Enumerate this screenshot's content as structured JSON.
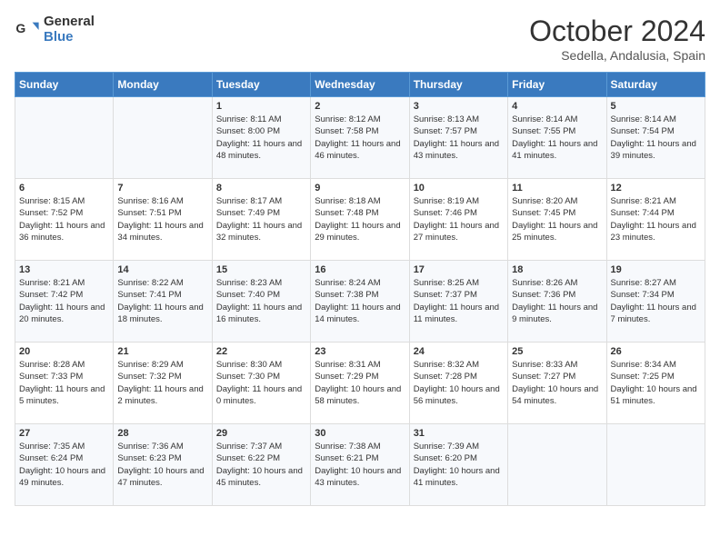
{
  "logo": {
    "text_general": "General",
    "text_blue": "Blue"
  },
  "title": "October 2024",
  "subtitle": "Sedella, Andalusia, Spain",
  "days_of_week": [
    "Sunday",
    "Monday",
    "Tuesday",
    "Wednesday",
    "Thursday",
    "Friday",
    "Saturday"
  ],
  "weeks": [
    [
      {
        "day": "",
        "sunrise": "",
        "sunset": "",
        "daylight": ""
      },
      {
        "day": "",
        "sunrise": "",
        "sunset": "",
        "daylight": ""
      },
      {
        "day": "1",
        "sunrise": "Sunrise: 8:11 AM",
        "sunset": "Sunset: 8:00 PM",
        "daylight": "Daylight: 11 hours and 48 minutes."
      },
      {
        "day": "2",
        "sunrise": "Sunrise: 8:12 AM",
        "sunset": "Sunset: 7:58 PM",
        "daylight": "Daylight: 11 hours and 46 minutes."
      },
      {
        "day": "3",
        "sunrise": "Sunrise: 8:13 AM",
        "sunset": "Sunset: 7:57 PM",
        "daylight": "Daylight: 11 hours and 43 minutes."
      },
      {
        "day": "4",
        "sunrise": "Sunrise: 8:14 AM",
        "sunset": "Sunset: 7:55 PM",
        "daylight": "Daylight: 11 hours and 41 minutes."
      },
      {
        "day": "5",
        "sunrise": "Sunrise: 8:14 AM",
        "sunset": "Sunset: 7:54 PM",
        "daylight": "Daylight: 11 hours and 39 minutes."
      }
    ],
    [
      {
        "day": "6",
        "sunrise": "Sunrise: 8:15 AM",
        "sunset": "Sunset: 7:52 PM",
        "daylight": "Daylight: 11 hours and 36 minutes."
      },
      {
        "day": "7",
        "sunrise": "Sunrise: 8:16 AM",
        "sunset": "Sunset: 7:51 PM",
        "daylight": "Daylight: 11 hours and 34 minutes."
      },
      {
        "day": "8",
        "sunrise": "Sunrise: 8:17 AM",
        "sunset": "Sunset: 7:49 PM",
        "daylight": "Daylight: 11 hours and 32 minutes."
      },
      {
        "day": "9",
        "sunrise": "Sunrise: 8:18 AM",
        "sunset": "Sunset: 7:48 PM",
        "daylight": "Daylight: 11 hours and 29 minutes."
      },
      {
        "day": "10",
        "sunrise": "Sunrise: 8:19 AM",
        "sunset": "Sunset: 7:46 PM",
        "daylight": "Daylight: 11 hours and 27 minutes."
      },
      {
        "day": "11",
        "sunrise": "Sunrise: 8:20 AM",
        "sunset": "Sunset: 7:45 PM",
        "daylight": "Daylight: 11 hours and 25 minutes."
      },
      {
        "day": "12",
        "sunrise": "Sunrise: 8:21 AM",
        "sunset": "Sunset: 7:44 PM",
        "daylight": "Daylight: 11 hours and 23 minutes."
      }
    ],
    [
      {
        "day": "13",
        "sunrise": "Sunrise: 8:21 AM",
        "sunset": "Sunset: 7:42 PM",
        "daylight": "Daylight: 11 hours and 20 minutes."
      },
      {
        "day": "14",
        "sunrise": "Sunrise: 8:22 AM",
        "sunset": "Sunset: 7:41 PM",
        "daylight": "Daylight: 11 hours and 18 minutes."
      },
      {
        "day": "15",
        "sunrise": "Sunrise: 8:23 AM",
        "sunset": "Sunset: 7:40 PM",
        "daylight": "Daylight: 11 hours and 16 minutes."
      },
      {
        "day": "16",
        "sunrise": "Sunrise: 8:24 AM",
        "sunset": "Sunset: 7:38 PM",
        "daylight": "Daylight: 11 hours and 14 minutes."
      },
      {
        "day": "17",
        "sunrise": "Sunrise: 8:25 AM",
        "sunset": "Sunset: 7:37 PM",
        "daylight": "Daylight: 11 hours and 11 minutes."
      },
      {
        "day": "18",
        "sunrise": "Sunrise: 8:26 AM",
        "sunset": "Sunset: 7:36 PM",
        "daylight": "Daylight: 11 hours and 9 minutes."
      },
      {
        "day": "19",
        "sunrise": "Sunrise: 8:27 AM",
        "sunset": "Sunset: 7:34 PM",
        "daylight": "Daylight: 11 hours and 7 minutes."
      }
    ],
    [
      {
        "day": "20",
        "sunrise": "Sunrise: 8:28 AM",
        "sunset": "Sunset: 7:33 PM",
        "daylight": "Daylight: 11 hours and 5 minutes."
      },
      {
        "day": "21",
        "sunrise": "Sunrise: 8:29 AM",
        "sunset": "Sunset: 7:32 PM",
        "daylight": "Daylight: 11 hours and 2 minutes."
      },
      {
        "day": "22",
        "sunrise": "Sunrise: 8:30 AM",
        "sunset": "Sunset: 7:30 PM",
        "daylight": "Daylight: 11 hours and 0 minutes."
      },
      {
        "day": "23",
        "sunrise": "Sunrise: 8:31 AM",
        "sunset": "Sunset: 7:29 PM",
        "daylight": "Daylight: 10 hours and 58 minutes."
      },
      {
        "day": "24",
        "sunrise": "Sunrise: 8:32 AM",
        "sunset": "Sunset: 7:28 PM",
        "daylight": "Daylight: 10 hours and 56 minutes."
      },
      {
        "day": "25",
        "sunrise": "Sunrise: 8:33 AM",
        "sunset": "Sunset: 7:27 PM",
        "daylight": "Daylight: 10 hours and 54 minutes."
      },
      {
        "day": "26",
        "sunrise": "Sunrise: 8:34 AM",
        "sunset": "Sunset: 7:25 PM",
        "daylight": "Daylight: 10 hours and 51 minutes."
      }
    ],
    [
      {
        "day": "27",
        "sunrise": "Sunrise: 7:35 AM",
        "sunset": "Sunset: 6:24 PM",
        "daylight": "Daylight: 10 hours and 49 minutes."
      },
      {
        "day": "28",
        "sunrise": "Sunrise: 7:36 AM",
        "sunset": "Sunset: 6:23 PM",
        "daylight": "Daylight: 10 hours and 47 minutes."
      },
      {
        "day": "29",
        "sunrise": "Sunrise: 7:37 AM",
        "sunset": "Sunset: 6:22 PM",
        "daylight": "Daylight: 10 hours and 45 minutes."
      },
      {
        "day": "30",
        "sunrise": "Sunrise: 7:38 AM",
        "sunset": "Sunset: 6:21 PM",
        "daylight": "Daylight: 10 hours and 43 minutes."
      },
      {
        "day": "31",
        "sunrise": "Sunrise: 7:39 AM",
        "sunset": "Sunset: 6:20 PM",
        "daylight": "Daylight: 10 hours and 41 minutes."
      },
      {
        "day": "",
        "sunrise": "",
        "sunset": "",
        "daylight": ""
      },
      {
        "day": "",
        "sunrise": "",
        "sunset": "",
        "daylight": ""
      }
    ]
  ]
}
